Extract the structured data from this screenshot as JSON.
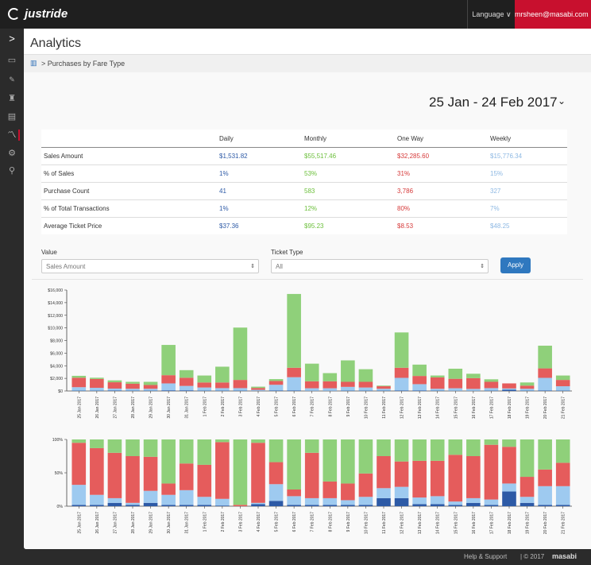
{
  "app": {
    "name": "justride"
  },
  "topbar": {
    "language_label": "Language ∨",
    "user_email": "mrsheen@masabi.com ∨"
  },
  "sidebar": {
    "icons": [
      "expand-icon",
      "monitor-icon",
      "ticket-icon",
      "user-icon",
      "document-icon",
      "analytics-icon",
      "settings-icon",
      "location-icon"
    ]
  },
  "page": {
    "title": "Analytics",
    "breadcrumb": "> Purchases by Fare Type"
  },
  "date_range": "25 Jan - 24 Feb 2017",
  "stats": {
    "headers": [
      "",
      "Daily",
      "Monthly",
      "One Way",
      "Weekly"
    ],
    "rows": [
      [
        "Sales Amount",
        "$1,531.82",
        "$55,517.46",
        "$32,285.60",
        "$15,776.34"
      ],
      [
        "% of Sales",
        "1%",
        "53%",
        "31%",
        "15%"
      ],
      [
        "Purchase Count",
        "41",
        "583",
        "3,786",
        "327"
      ],
      [
        "% of Total Transactions",
        "1%",
        "12%",
        "80%",
        "7%"
      ],
      [
        "Average Ticket Price",
        "$37.36",
        "$95.23",
        "$8.53",
        "$48.25"
      ]
    ]
  },
  "filters": {
    "value_label": "Value",
    "value_selected": "Sales Amount",
    "ticket_type_label": "Ticket Type",
    "ticket_type_selected": "All",
    "apply_label": "Apply"
  },
  "colors": {
    "daily": "#2d5aa6",
    "monthly": "#8fd07a",
    "one_way": "#e55c5c",
    "weekly": "#9ecaf0",
    "accent": "#c8102e",
    "button": "#2f78bf"
  },
  "chart_data": [
    {
      "type": "bar",
      "stacked": true,
      "categories": [
        "25 Jan 2017",
        "26 Jan 2017",
        "27 Jan 2017",
        "28 Jan 2017",
        "29 Jan 2017",
        "30 Jan 2017",
        "31 Jan 2017",
        "1 Feb 2017",
        "2 Feb 2017",
        "3 Feb 2017",
        "4 Feb 2017",
        "5 Feb 2017",
        "6 Feb 2017",
        "7 Feb 2017",
        "8 Feb 2017",
        "9 Feb 2017",
        "10 Feb 2017",
        "11 Feb 2017",
        "12 Feb 2017",
        "13 Feb 2017",
        "14 Feb 2017",
        "15 Feb 2017",
        "16 Feb 2017",
        "17 Feb 2017",
        "18 Feb 2017",
        "19 Feb 2017",
        "20 Feb 2017",
        "21 Feb 2017"
      ],
      "ylim": [
        0,
        16000
      ],
      "yticks": [
        "$0",
        "$2,000",
        "$4,000",
        "$6,000",
        "$8,000",
        "$10,000",
        "$12,000",
        "$14,000",
        "$16,000"
      ],
      "series": [
        {
          "name": "Daily",
          "values": [
            50,
            50,
            80,
            50,
            50,
            100,
            100,
            50,
            50,
            50,
            30,
            80,
            80,
            30,
            30,
            50,
            50,
            50,
            80,
            80,
            50,
            30,
            30,
            50,
            200,
            50,
            80,
            50
          ]
        },
        {
          "name": "Weekly",
          "values": [
            550,
            450,
            300,
            300,
            300,
            1100,
            700,
            500,
            400,
            400,
            150,
            900,
            2100,
            400,
            400,
            600,
            500,
            300,
            2000,
            1000,
            300,
            400,
            300,
            400,
            200,
            300,
            2000,
            700
          ]
        },
        {
          "name": "One Way",
          "values": [
            1500,
            1400,
            1000,
            800,
            600,
            1300,
            1300,
            800,
            900,
            1300,
            300,
            600,
            1500,
            1100,
            1100,
            800,
            900,
            400,
            1600,
            1300,
            1800,
            1500,
            1700,
            1000,
            800,
            500,
            1500,
            1000
          ]
        },
        {
          "name": "Monthly",
          "values": [
            300,
            200,
            300,
            300,
            500,
            4800,
            1200,
            1100,
            2500,
            8300,
            200,
            300,
            11700,
            2800,
            1300,
            3400,
            2000,
            100,
            5600,
            1800,
            300,
            1600,
            700,
            400,
            0,
            500,
            3600,
            700
          ]
        }
      ]
    },
    {
      "type": "bar",
      "stacked": true,
      "percent": true,
      "categories": [
        "25 Jan 2017",
        "26 Jan 2017",
        "27 Jan 2017",
        "28 Jan 2017",
        "29 Jan 2017",
        "30 Jan 2017",
        "31 Jan 2017",
        "1 Feb 2017",
        "2 Feb 2017",
        "3 Feb 2017",
        "4 Feb 2017",
        "5 Feb 2017",
        "6 Feb 2017",
        "7 Feb 2017",
        "8 Feb 2017",
        "9 Feb 2017",
        "10 Feb 2017",
        "11 Feb 2017",
        "12 Feb 2017",
        "13 Feb 2017",
        "14 Feb 2017",
        "15 Feb 2017",
        "16 Feb 2017",
        "17 Feb 2017",
        "18 Feb 2017",
        "19 Feb 2017",
        "20 Feb 2017",
        "21 Feb 2017"
      ],
      "ylim": [
        0,
        100
      ],
      "yticks": [
        "0%",
        "50%",
        "100%"
      ],
      "series": [
        {
          "name": "Daily",
          "values": [
            2,
            2,
            5,
            2,
            5,
            2,
            2,
            2,
            1,
            0,
            3,
            8,
            2,
            2,
            2,
            2,
            2,
            12,
            12,
            3,
            3,
            2,
            5,
            2,
            22,
            5,
            2,
            2
          ]
        },
        {
          "name": "Weekly",
          "values": [
            30,
            15,
            7,
            3,
            18,
            15,
            22,
            12,
            10,
            0,
            2,
            25,
            13,
            10,
            10,
            7,
            12,
            15,
            17,
            10,
            12,
            5,
            7,
            8,
            12,
            9,
            28,
            28
          ]
        },
        {
          "name": "One Way",
          "values": [
            63,
            70,
            68,
            70,
            51,
            17,
            40,
            48,
            85,
            2,
            90,
            33,
            10,
            68,
            25,
            25,
            35,
            48,
            38,
            55,
            53,
            70,
            63,
            82,
            55,
            30,
            25,
            35
          ]
        },
        {
          "name": "Monthly",
          "values": [
            5,
            13,
            20,
            25,
            26,
            66,
            36,
            38,
            4,
            98,
            5,
            34,
            75,
            20,
            63,
            66,
            51,
            25,
            33,
            32,
            32,
            23,
            25,
            8,
            11,
            56,
            45,
            35
          ]
        }
      ]
    }
  ],
  "footer": {
    "help": "Help & Support",
    "copyright": "| © 2017",
    "brand": "masabi"
  }
}
